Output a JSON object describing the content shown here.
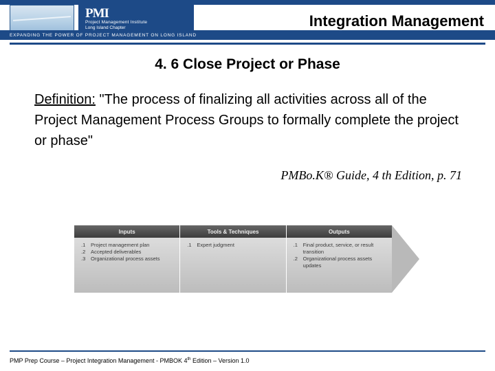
{
  "banner": {
    "pmi": "PMI",
    "org_line1": "Project Management Institute",
    "org_line2": "Long Island Chapter",
    "tagline": "EXPANDING THE POWER OF PROJECT MANAGEMENT ON LONG ISLAND",
    "title": "Integration Management"
  },
  "heading": "4. 6 Close Project or Phase",
  "definition": {
    "label": "Definition:",
    "text": " \"The process of finalizing all activities across all of the Project Management Process Groups to formally complete the project or phase\""
  },
  "citation": "PMBo.K® Guide, 4 th Edition, p. 71",
  "diagram": {
    "columns": [
      {
        "header": "Inputs",
        "items": [
          {
            "num": ".1",
            "text": "Project management plan"
          },
          {
            "num": ".2",
            "text": "Accepted deliverables"
          },
          {
            "num": ".3",
            "text": "Organizational process assets"
          }
        ]
      },
      {
        "header": "Tools & Techniques",
        "items": [
          {
            "num": ".1",
            "text": "Expert judgment"
          }
        ]
      },
      {
        "header": "Outputs",
        "items": [
          {
            "num": ".1",
            "text": "Final product, service, or result transition"
          },
          {
            "num": ".2",
            "text": "Organizational process assets updates"
          }
        ]
      }
    ]
  },
  "footer": {
    "text_pre": "PMP Prep Course – Project Integration Management - PMBOK 4",
    "text_sup": "th",
    "text_post": " Edition – Version 1.0"
  }
}
